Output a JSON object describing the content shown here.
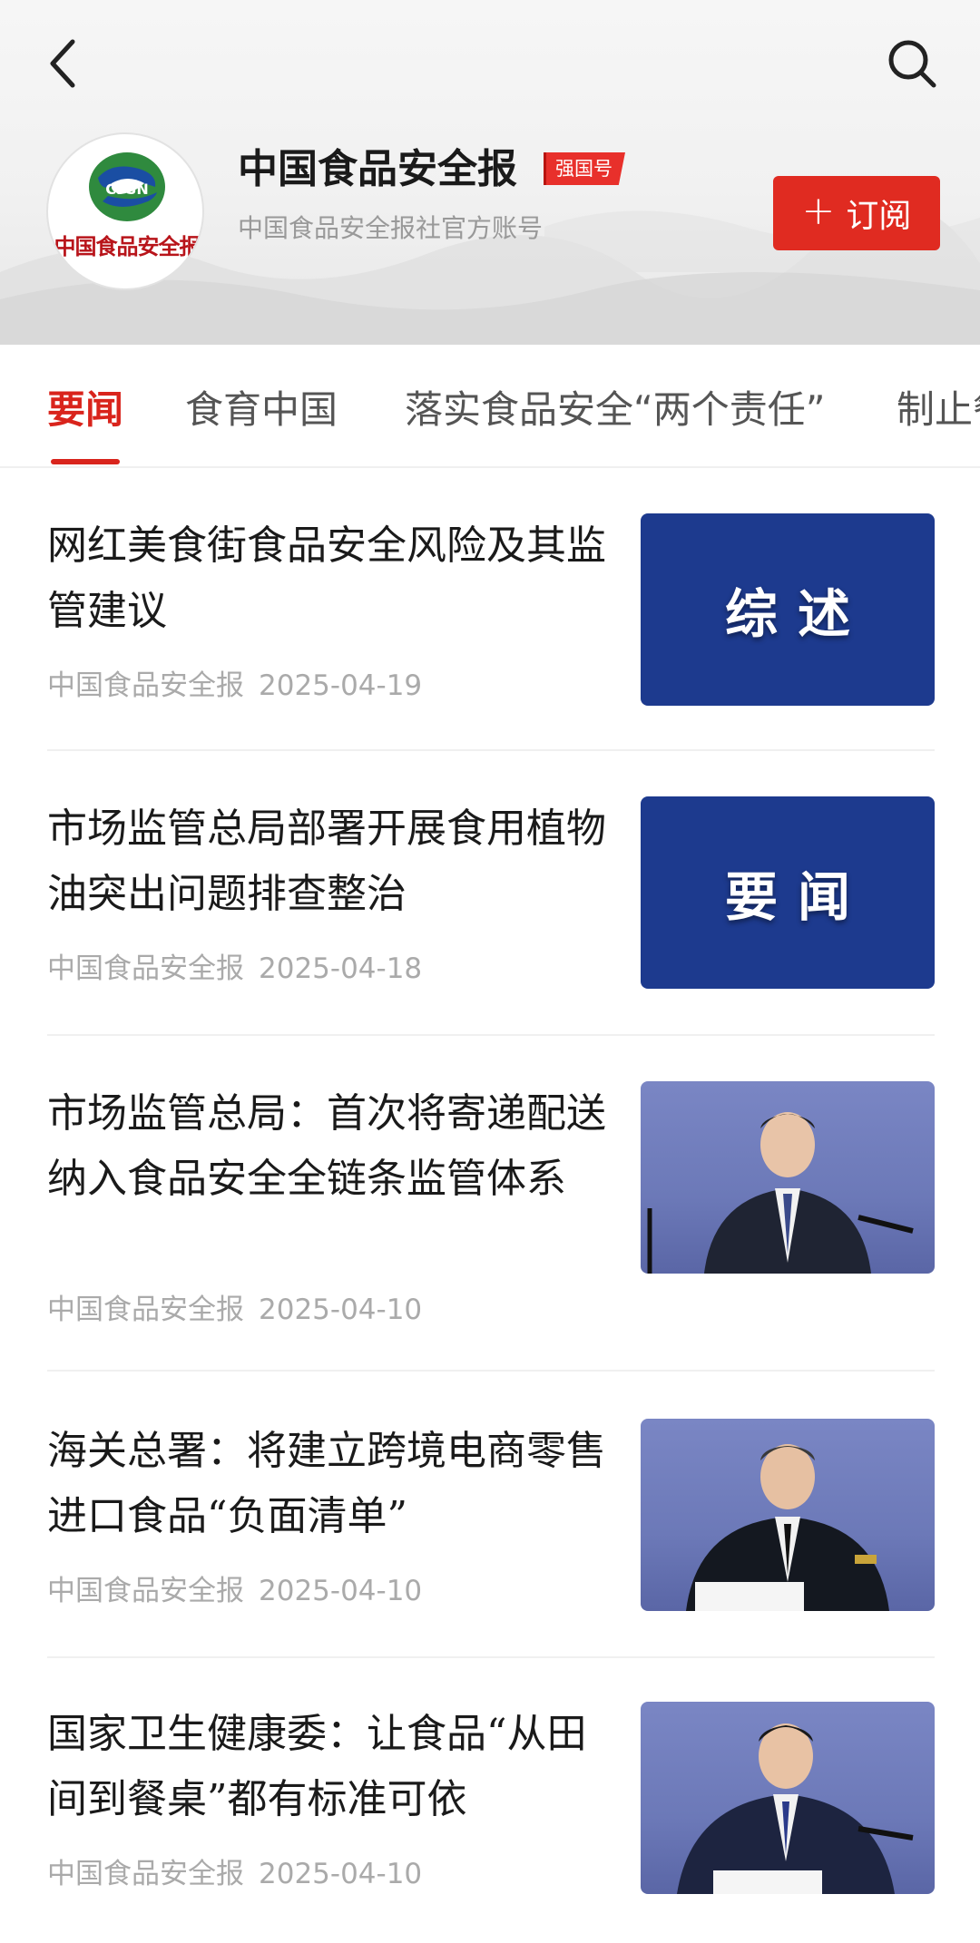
{
  "account": {
    "name": "中国食品安全报",
    "badge": "强国号",
    "description": "中国食品安全报社官方账号",
    "logo_text": "中国食品安全报",
    "logo_abbr": "CFSN",
    "subscribe_label": "订阅"
  },
  "tabs": [
    {
      "label": "要闻",
      "active": true
    },
    {
      "label": "食育中国",
      "active": false
    },
    {
      "label": "落实食品安全“两个责任”",
      "active": false
    },
    {
      "label": "制止餐",
      "active": false
    }
  ],
  "news": [
    {
      "title": "网红美食街食品安全风险及其监管建议",
      "source": "中国食品安全报",
      "date": "2025-04-19",
      "thumb_text": "综述"
    },
    {
      "title": "市场监管总局部署开展食用植物油突出问题排查整治",
      "source": "中国食品安全报",
      "date": "2025-04-18",
      "thumb_text": "要闻"
    },
    {
      "title": "市场监管总局：首次将寄递配送纳入食品安全全链条监管体系",
      "source": "中国食品安全报",
      "date": "2025-04-10",
      "thumb_text": ""
    },
    {
      "title": "海关总署：将建立跨境电商零售进口食品“负面清单”",
      "source": "中国食品安全报",
      "date": "2025-04-10",
      "thumb_text": ""
    },
    {
      "title": "国家卫生健康委：让食品“从田间到餐桌”都有标准可依",
      "source": "中国食品安全报",
      "date": "2025-04-10",
      "thumb_text": ""
    }
  ],
  "colors": {
    "accent": "#d9241c",
    "subscribe_bg": "#e02b21",
    "thumb_blue": "#1d3a8e",
    "photo_bg": "#6c79b8"
  },
  "icons": {
    "back": "chevron-left-icon",
    "search": "search-icon",
    "plus": "plus-icon"
  }
}
